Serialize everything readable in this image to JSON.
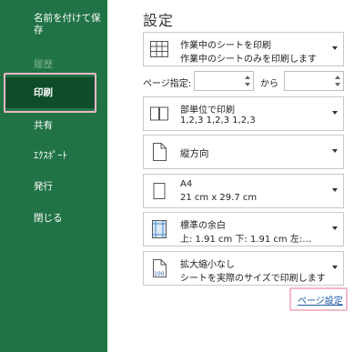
{
  "nav": {
    "items": [
      {
        "label": "名前を付けて保存",
        "state": "normal"
      },
      {
        "label": "履歴",
        "state": "disabled"
      },
      {
        "label": "印刷",
        "state": "active"
      },
      {
        "label": "共有",
        "state": "normal"
      },
      {
        "label": "ｴｸｽﾎﾟｰﾄ",
        "state": "normal"
      },
      {
        "label": "発行",
        "state": "normal"
      },
      {
        "label": "閉じる",
        "state": "normal"
      }
    ]
  },
  "settings": {
    "title": "設定",
    "print_what": {
      "line1": "作業中のシートを印刷",
      "line2": "作業中のシートのみを印刷します"
    },
    "pages": {
      "label": "ページ指定:",
      "to_label": "から",
      "from_value": "",
      "to_value": ""
    },
    "collate": {
      "line1": "部単位で印刷",
      "line2": "1,2,3    1,2,3    1,2,3"
    },
    "orientation": {
      "label": "縦方向"
    },
    "paper": {
      "line1": "A4",
      "line2": "21 cm x 29.7 cm"
    },
    "margins": {
      "line1": "標準の余白",
      "line2": "上: 1.91 cm 下: 1.91 cm 左:…"
    },
    "scaling": {
      "line1": "拡大縮小なし",
      "line2": "シートを実際のサイズで印刷します",
      "icon_text": "100"
    },
    "page_setup_link": "ページ設定"
  },
  "colors": {
    "nav_bg": "#217346",
    "nav_active": "#0f4d2a",
    "highlight": "#f2b8c6",
    "link": "#1e5aa6"
  }
}
